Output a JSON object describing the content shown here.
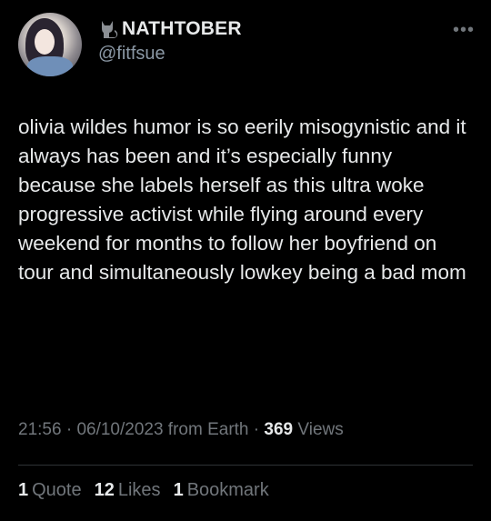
{
  "user": {
    "display_name": "NATHTOBER",
    "handle": "@fitfsue",
    "badge_icon": "cat-icon"
  },
  "tweet": {
    "text": "olivia wildes humor is so eerily misogynistic and it always has been and it’s especially funny because she labels herself as this ultra woke progressive activist while flying around every weekend for months to follow her boyfriend on tour and simultaneously lowkey being a bad mom"
  },
  "meta": {
    "time": "21:56",
    "sep1": " · ",
    "date": "06/10/2023",
    "source": " from Earth",
    "sep2": " · ",
    "views_count": "369",
    "views_label": " Views"
  },
  "stats": {
    "quotes_count": "1",
    "quotes_label": "Quote",
    "likes_count": "12",
    "likes_label": "Likes",
    "bookmarks_count": "1",
    "bookmarks_label": "Bookmark"
  },
  "more_glyph": "•••",
  "colors": {
    "background": "#000000",
    "text": "#e7e9ea",
    "muted": "#71767b",
    "divider": "#2f3336"
  }
}
